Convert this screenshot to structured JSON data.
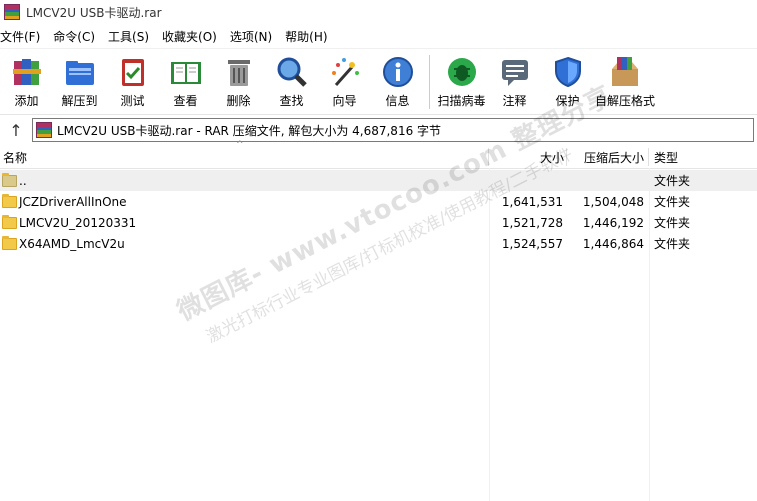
{
  "window": {
    "title": "LMCV2U USB卡驱动.rar"
  },
  "menu": [
    "文件(F)",
    "命令(C)",
    "工具(S)",
    "收藏夹(O)",
    "选项(N)",
    "帮助(H)"
  ],
  "toolbar": {
    "add": "添加",
    "extract": "解压到",
    "test": "测试",
    "view": "查看",
    "delete": "删除",
    "find": "查找",
    "wizard": "向导",
    "info": "信息",
    "scan": "扫描病毒",
    "comment": "注释",
    "protect": "保护",
    "sfx": "自解压格式"
  },
  "address": {
    "up_glyph": "↑",
    "text": "LMCV2U USB卡驱动.rar - RAR 压缩文件, 解包大小为 4,687,816 字节"
  },
  "columns": {
    "name": "名称",
    "size": "大小",
    "packed": "压缩后大小",
    "type": "类型",
    "sort_glyph": "^"
  },
  "rows": [
    {
      "name": "..",
      "size": "",
      "packed": "",
      "type": "文件夹"
    },
    {
      "name": "JCZDriverAllInOne",
      "size": "1,641,531",
      "packed": "1,504,048",
      "type": "文件夹"
    },
    {
      "name": "LMCV2U_20120331",
      "size": "1,521,728",
      "packed": "1,446,192",
      "type": "文件夹"
    },
    {
      "name": "X64AMD_LmcV2u",
      "size": "1,524,557",
      "packed": "1,446,864",
      "type": "文件夹"
    }
  ],
  "watermark": {
    "line1": "微图库- www.vtocoo.com 整理分享",
    "line2": "激光打标行业专业图库/打标机校准/使用教程/二手软件"
  }
}
